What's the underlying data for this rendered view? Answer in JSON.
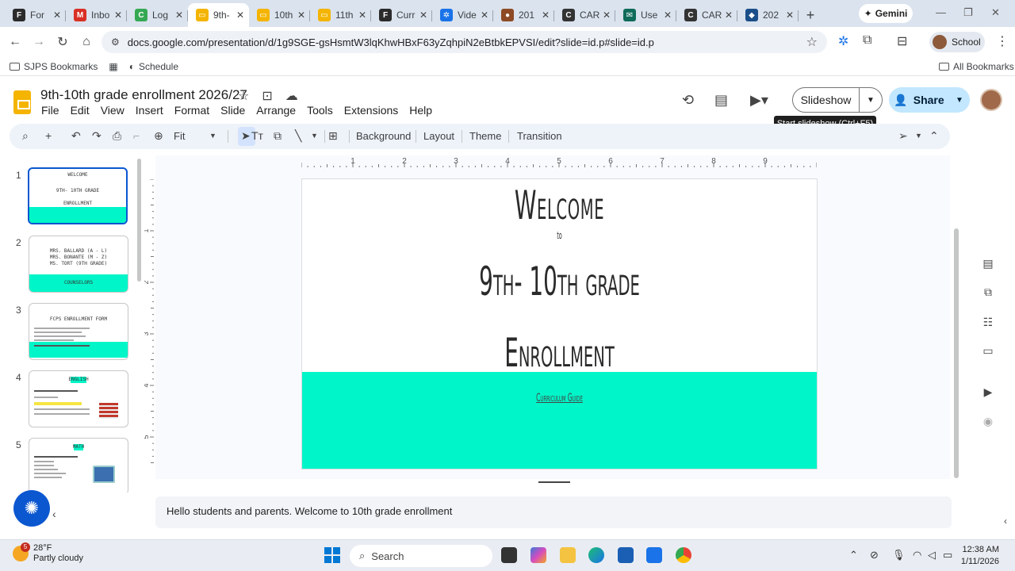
{
  "browser": {
    "tabs": [
      {
        "label": "For",
        "color": "#2b2b2b",
        "glyph": "F"
      },
      {
        "label": "Inbo",
        "color": "#d93025",
        "glyph": "M"
      },
      {
        "label": "Log",
        "color": "#34a853",
        "glyph": "C"
      },
      {
        "label": "9th-",
        "color": "#f4b400",
        "glyph": "▭",
        "active": true
      },
      {
        "label": "10th",
        "color": "#f4b400",
        "glyph": "▭"
      },
      {
        "label": "11th",
        "color": "#f4b400",
        "glyph": "▭"
      },
      {
        "label": "Curr",
        "color": "#2b2b2b",
        "glyph": "F"
      },
      {
        "label": "Vide",
        "color": "#1a73e8",
        "glyph": "✲"
      },
      {
        "label": "201",
        "color": "#8d4a24",
        "glyph": "●"
      },
      {
        "label": "CAR",
        "color": "#333333",
        "glyph": "C"
      },
      {
        "label": "Use",
        "color": "#0f6b5a",
        "glyph": "✉"
      },
      {
        "label": "CAR",
        "color": "#333333",
        "glyph": "C"
      },
      {
        "label": "202",
        "color": "#1a4f8a",
        "glyph": "◆"
      }
    ],
    "new_tab": "+",
    "gemini_label": "Gemini",
    "url": "docs.google.com/presentation/d/1g9SGE-gsHsmtW3lqKhwHBxF63yZqhpiN2eBtbkEPVSI/edit?slide=id.p#slide=id.p",
    "profile_label": "School",
    "bookmarks": [
      {
        "label": "SJPS Bookmarks"
      },
      {
        "label": "Schedule"
      }
    ],
    "all_bookmarks": "All Bookmarks"
  },
  "doc": {
    "title": "9th-10th grade enrollment 2026/27",
    "menu": [
      "File",
      "Edit",
      "View",
      "Insert",
      "Format",
      "Slide",
      "Arrange",
      "Tools",
      "Extensions",
      "Help"
    ],
    "slideshow_label": "Slideshow",
    "share_label": "Share",
    "tooltip": "Start slideshow (Ctrl+F5)"
  },
  "toolbar": {
    "zoom": "Fit",
    "background": "Background",
    "layout": "Layout",
    "theme": "Theme",
    "transition": "Transition"
  },
  "filmstrip": {
    "slides": [
      {
        "num": "1",
        "lines": [
          "WELCOME",
          "9TH- 10TH GRADE",
          "ENROLLMENT"
        ]
      },
      {
        "num": "2",
        "lines": [
          "MRS. BALLARD (A - L)",
          "MRS. BONANTE (M - Z)",
          "MS. TORT (9TH GRADE)"
        ],
        "band": "COUNSELORS"
      },
      {
        "num": "3",
        "lines": [
          "FCPS ENROLLMENT FORM"
        ]
      },
      {
        "num": "4",
        "lines": [
          "ENGLISH"
        ]
      },
      {
        "num": "5",
        "lines": [
          "MATH"
        ]
      }
    ]
  },
  "ruler": {
    "top": [
      "1",
      "2",
      "3",
      "4",
      "5",
      "6",
      "7",
      "8",
      "9"
    ],
    "left": [
      "1",
      "2",
      "3",
      "4",
      "5"
    ]
  },
  "slide": {
    "welcome": "Welcome",
    "to": "to",
    "grade": "9th- 10th grade",
    "enrollment": "Enrollment",
    "link": "Curriculum Guide",
    "band_color": "#00f5c8"
  },
  "notes": "Hello students and parents. Welcome to 10th grade enrollment",
  "taskbar": {
    "weather_temp": "28°F",
    "weather_desc": "Partly cloudy",
    "weather_badge": "5",
    "search": "Search",
    "time": "12:38 AM",
    "date": "1/11/2026"
  }
}
